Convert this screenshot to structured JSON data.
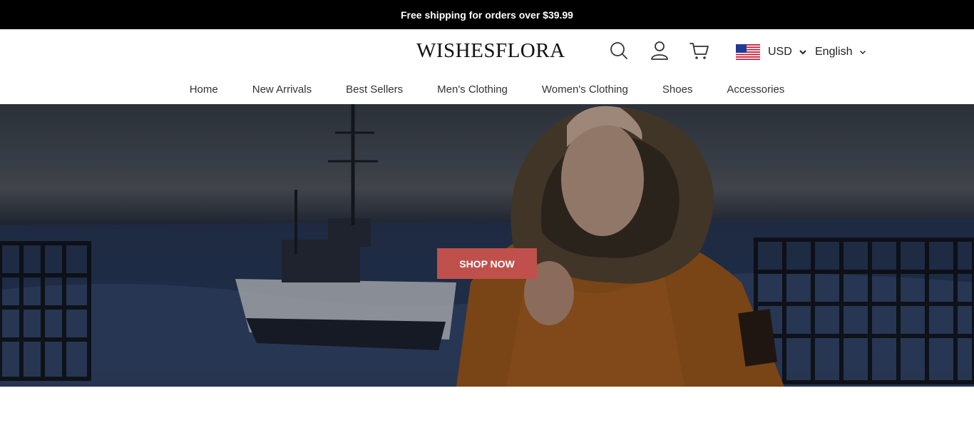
{
  "announcement": {
    "text": "Free shipping for orders over $39.99"
  },
  "header": {
    "logo": "WISHESFLORA",
    "icons": [
      "search-icon",
      "account-icon",
      "cart-icon"
    ],
    "currency": {
      "flag": "us-flag-icon",
      "value": "USD"
    },
    "language": {
      "value": "English"
    }
  },
  "nav": {
    "items": [
      {
        "label": "Home"
      },
      {
        "label": "New Arrivals"
      },
      {
        "label": "Best Sellers"
      },
      {
        "label": "Men's Clothing"
      },
      {
        "label": "Women's Clothing"
      },
      {
        "label": "Shoes"
      },
      {
        "label": "Accessories"
      }
    ]
  },
  "hero": {
    "cta_label": "SHOP NOW",
    "cta_color": "#c0504c"
  }
}
